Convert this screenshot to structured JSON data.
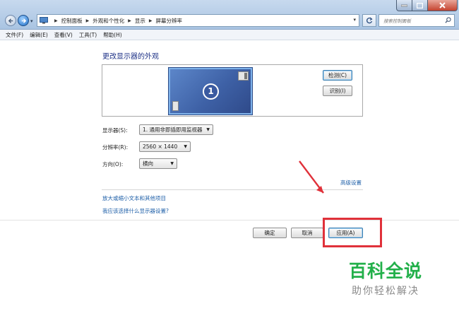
{
  "address": {
    "crumbs": [
      "控制面板",
      "外观和个性化",
      "显示",
      "屏幕分辨率"
    ]
  },
  "search": {
    "placeholder": "搜索控制面板"
  },
  "menu": [
    "文件(F)",
    "编辑(E)",
    "查看(V)",
    "工具(T)",
    "帮助(H)"
  ],
  "main": {
    "title": "更改显示器的外观",
    "monitor_number": "1",
    "detect_label": "检测(C)",
    "identify_label": "识别(I)",
    "display_label": "显示器(S):",
    "display_value": "1. 通用非即插即用监视器",
    "resolution_label": "分辨率(R):",
    "resolution_value": "2560 × 1440",
    "orientation_label": "方向(O):",
    "orientation_value": "横向",
    "advanced_link": "高级设置",
    "link_text_size": "放大或缩小文本和其他项目",
    "link_which_settings": "我应该选择什么显示器设置?"
  },
  "footer": {
    "ok_label": "确定",
    "cancel_label": "取消",
    "apply_label": "应用(A)"
  },
  "watermark": {
    "title": "百科全说",
    "subtitle": "助你轻松解决"
  },
  "colors": {
    "annotation_red": "#e0313a",
    "watermark_green": "#22b04a",
    "link_blue": "#1e5fa8",
    "title_blue": "#1e3287"
  }
}
